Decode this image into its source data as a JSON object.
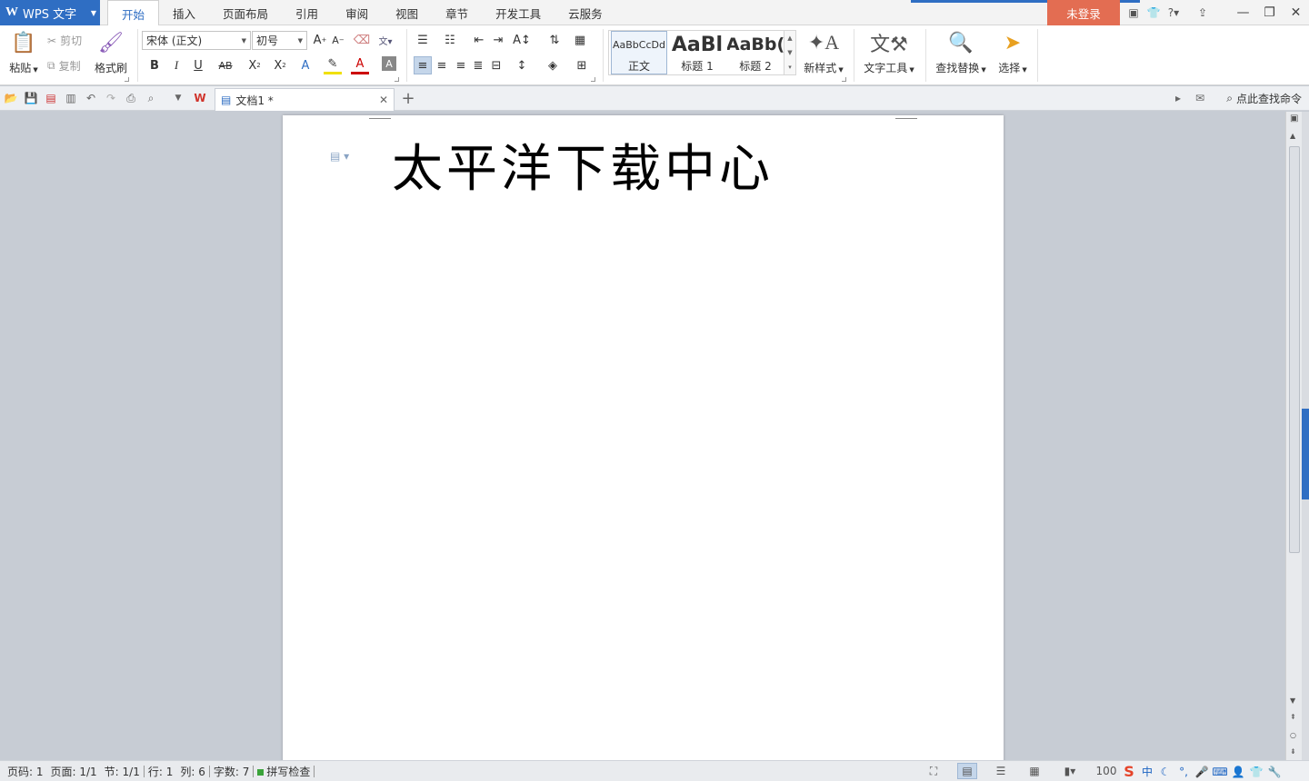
{
  "app": {
    "logo": "W",
    "name": "WPS 文字"
  },
  "menu": {
    "tabs": [
      "开始",
      "插入",
      "页面布局",
      "引用",
      "审阅",
      "视图",
      "章节",
      "开发工具",
      "云服务"
    ],
    "active": "开始"
  },
  "login": "未登录",
  "ribbon": {
    "paste": "粘贴",
    "cut": "剪切",
    "copy": "复制",
    "format_painter": "格式刷",
    "font_name": "宋体 (正文)",
    "font_size": "初号",
    "styles": [
      {
        "preview": "AaBbCcDd",
        "name": "正文"
      },
      {
        "preview": "AaBl",
        "name": "标题 1"
      },
      {
        "preview": "AaBb(",
        "name": "标题 2"
      }
    ],
    "new_style": "新样式",
    "text_tools": "文字工具",
    "find_replace": "查找替换",
    "select": "选择"
  },
  "doc_tab": {
    "title": "文档1 *"
  },
  "search_cmd": "点此查找命令",
  "document": {
    "text": "太平洋下载中心"
  },
  "status": {
    "page": "页码: 1",
    "pages": "页面: 1/1",
    "section": "节: 1/1",
    "line": "行: 1",
    "col": "列: 6",
    "words": "字数: 7",
    "spell": "拼写检查",
    "zoom": "100"
  },
  "ime": {
    "mode": "中"
  },
  "colors": {
    "accent": "#2f6ec3",
    "login_bg": "#e36d52",
    "workspace": "#c7ccd4"
  }
}
